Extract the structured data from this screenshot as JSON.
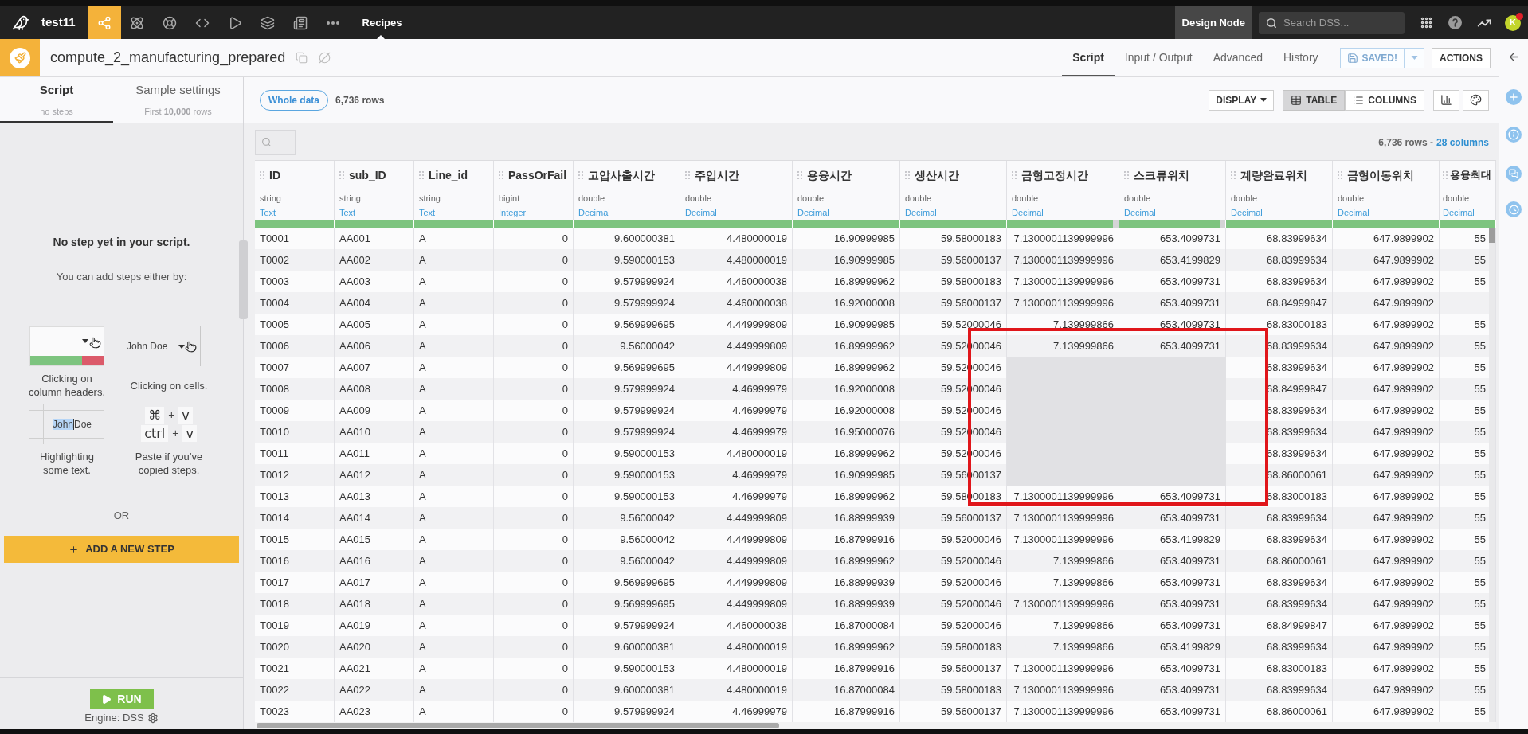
{
  "nav": {
    "project": "test11",
    "apps": [
      {
        "kind": "flow",
        "selected": true
      },
      {
        "kind": "lab",
        "selected": false
      },
      {
        "kind": "ml",
        "selected": false
      },
      {
        "kind": "code",
        "selected": false
      },
      {
        "kind": "run",
        "selected": false
      },
      {
        "kind": "stack",
        "selected": false
      },
      {
        "kind": "dashboard",
        "selected": false
      },
      {
        "kind": "more",
        "selected": false
      }
    ],
    "section": "Recipes",
    "node": "Design Node",
    "search": {
      "placeholder": "Search DSS..."
    },
    "avatar": {
      "initial": "K",
      "notification": true
    }
  },
  "recipe": {
    "title": "compute_2_manufacturing_prepared",
    "tabs": [
      {
        "label": "Script",
        "selected": true
      },
      {
        "label": "Input / Output",
        "selected": false
      },
      {
        "label": "Advanced",
        "selected": false
      },
      {
        "label": "History",
        "selected": false
      }
    ],
    "save_button": {
      "label": "SAVED!",
      "disabled": true
    },
    "actions_button": "ACTIONS"
  },
  "left_panel": {
    "tabs": [
      {
        "label": "Script",
        "sublabel": "no steps",
        "selected": true
      },
      {
        "label": "Sample settings",
        "sublabel": "First **10,000** rows",
        "selected": false
      }
    ],
    "empty_title": "No step yet in your script.",
    "empty_hint": "You can add steps either by:",
    "tips": [
      {
        "kind": "header",
        "caption": [
          "Clicking on",
          "column headers."
        ]
      },
      {
        "kind": "cell",
        "sample": "John Doe",
        "caption": [
          "Clicking on cells."
        ]
      },
      {
        "kind": "highlight",
        "selected_text": "John",
        "rest_text": "Doe",
        "caption": [
          "Highlighting",
          "some text."
        ]
      },
      {
        "kind": "paste",
        "shortcuts": [
          [
            "⌘",
            "+",
            "v"
          ],
          [
            "ctrl",
            "+",
            "v"
          ]
        ],
        "caption": [
          "Paste if you’ve",
          "copied steps."
        ]
      }
    ],
    "or": "OR",
    "add_button": "ADD A NEW STEP",
    "run_button": "RUN",
    "engine": "Engine: DSS"
  },
  "toolbar": {
    "sample_button": "Whole data",
    "row_count": "6,736 rows",
    "display_button": "DISPLAY",
    "views": [
      {
        "label": "TABLE",
        "kind": "table",
        "selected": true
      },
      {
        "label": "COLUMNS",
        "kind": "columns",
        "selected": false
      }
    ]
  },
  "table": {
    "summary": {
      "rows": "6,736 rows",
      "separator": "-",
      "columns": "28 columns"
    },
    "columns": [
      {
        "name": "ID",
        "storage": "string",
        "meaning": "Text",
        "kind": "text",
        "level": 1
      },
      {
        "name": "sub_ID",
        "storage": "string",
        "meaning": "Text",
        "kind": "text",
        "level": 1
      },
      {
        "name": "Line_id",
        "storage": "string",
        "meaning": "Text",
        "kind": "text",
        "level": 1
      },
      {
        "name": "PassOrFail",
        "storage": "bigint",
        "meaning": "Integer",
        "kind": "number",
        "level": 1
      },
      {
        "name": "고압사출시간",
        "storage": "double",
        "meaning": "Decimal",
        "kind": "number",
        "level": 1
      },
      {
        "name": "주입시간",
        "storage": "double",
        "meaning": "Decimal",
        "kind": "number",
        "level": 1
      },
      {
        "name": "용융시간",
        "storage": "double",
        "meaning": "Decimal",
        "kind": "number",
        "level": 1
      },
      {
        "name": "생산시간",
        "storage": "double",
        "meaning": "Decimal",
        "kind": "number",
        "level": 1
      },
      {
        "name": "금형고정시간",
        "storage": "double",
        "meaning": "Decimal",
        "kind": "number",
        "level": 0.95
      },
      {
        "name": "스크류위치",
        "storage": "double",
        "meaning": "Decimal",
        "kind": "number",
        "level": 0.95
      },
      {
        "name": "계량완료위치",
        "storage": "double",
        "meaning": "Decimal",
        "kind": "number",
        "level": 1
      },
      {
        "name": "금형이동위치",
        "storage": "double",
        "meaning": "Decimal",
        "kind": "number",
        "level": 1
      },
      {
        "name": "용융최대",
        "storage": "double",
        "meaning": "Decimal",
        "kind": "number",
        "level": 1
      }
    ],
    "rows": [
      [
        "T0001",
        "AA001",
        "A",
        "0",
        "9.600000381",
        "4.480000019",
        "16.90999985",
        "59.58000183",
        "7.1300001139999996",
        "653.4099731",
        "68.83999634",
        "647.9899902",
        "55"
      ],
      [
        "T0002",
        "AA002",
        "A",
        "0",
        "9.590000153",
        "4.480000019",
        "16.90999985",
        "59.56000137",
        "7.1300001139999996",
        "653.4199829",
        "68.83999634",
        "647.9899902",
        "55"
      ],
      [
        "T0003",
        "AA003",
        "A",
        "0",
        "9.579999924",
        "4.460000038",
        "16.89999962",
        "59.58000183",
        "7.1300001139999996",
        "653.4099731",
        "68.83999634",
        "647.9899902",
        "55"
      ],
      [
        "T0004",
        "AA004",
        "A",
        "0",
        "9.579999924",
        "4.460000038",
        "16.92000008",
        "59.56000137",
        "7.1300001139999996",
        "653.4099731",
        "68.84999847",
        "647.9899902",
        null
      ],
      [
        "T0005",
        "AA005",
        "A",
        "0",
        "9.569999695",
        "4.449999809",
        "16.90999985",
        "59.52000046",
        "7.139999866",
        "653.4099731",
        "68.83000183",
        "647.9899902",
        "55"
      ],
      [
        "T0006",
        "AA006",
        "A",
        "0",
        "9.56000042",
        "4.449999809",
        "16.89999962",
        "59.52000046",
        "7.139999866",
        "653.4099731",
        "68.83999634",
        "647.9899902",
        "55"
      ],
      [
        "T0007",
        "AA007",
        "A",
        "0",
        "9.569999695",
        "4.449999809",
        "16.89999962",
        "59.52000046",
        null,
        null,
        "68.83999634",
        "647.9899902",
        "55"
      ],
      [
        "T0008",
        "AA008",
        "A",
        "0",
        "9.579999924",
        "4.46999979",
        "16.92000008",
        "59.52000046",
        null,
        null,
        "68.84999847",
        "647.9899902",
        "55"
      ],
      [
        "T0009",
        "AA009",
        "A",
        "0",
        "9.579999924",
        "4.46999979",
        "16.92000008",
        "59.52000046",
        null,
        null,
        "68.83999634",
        "647.9899902",
        "55"
      ],
      [
        "T0010",
        "AA010",
        "A",
        "0",
        "9.579999924",
        "4.46999979",
        "16.95000076",
        "59.52000046",
        null,
        null,
        "68.83999634",
        "647.9899902",
        "55"
      ],
      [
        "T0011",
        "AA011",
        "A",
        "0",
        "9.590000153",
        "4.480000019",
        "16.89999962",
        "59.52000046",
        null,
        null,
        "68.83999634",
        "647.9899902",
        "55"
      ],
      [
        "T0012",
        "AA012",
        "A",
        "0",
        "9.590000153",
        "4.46999979",
        "16.90999985",
        "59.56000137",
        null,
        null,
        "68.86000061",
        "647.9899902",
        "55"
      ],
      [
        "T0013",
        "AA013",
        "A",
        "0",
        "9.590000153",
        "4.46999979",
        "16.89999962",
        "59.58000183",
        "7.1300001139999996",
        "653.4099731",
        "68.83000183",
        "647.9899902",
        "55"
      ],
      [
        "T0014",
        "AA014",
        "A",
        "0",
        "9.56000042",
        "4.449999809",
        "16.88999939",
        "59.56000137",
        "7.1300001139999996",
        "653.4099731",
        "68.83999634",
        "647.9899902",
        "55"
      ],
      [
        "T0015",
        "AA015",
        "A",
        "0",
        "9.56000042",
        "4.449999809",
        "16.87999916",
        "59.52000046",
        "7.1300001139999996",
        "653.4199829",
        "68.83999634",
        "647.9899902",
        "55"
      ],
      [
        "T0016",
        "AA016",
        "A",
        "0",
        "9.56000042",
        "4.449999809",
        "16.89999962",
        "59.52000046",
        "7.139999866",
        "653.4099731",
        "68.86000061",
        "647.9899902",
        "55"
      ],
      [
        "T0017",
        "AA017",
        "A",
        "0",
        "9.569999695",
        "4.449999809",
        "16.88999939",
        "59.52000046",
        "7.139999866",
        "653.4099731",
        "68.83999634",
        "647.9899902",
        "55"
      ],
      [
        "T0018",
        "AA018",
        "A",
        "0",
        "9.569999695",
        "4.449999809",
        "16.88999939",
        "59.52000046",
        "7.1300001139999996",
        "653.4099731",
        "68.83999634",
        "647.9899902",
        "55"
      ],
      [
        "T0019",
        "AA019",
        "A",
        "0",
        "9.579999924",
        "4.460000038",
        "16.87000084",
        "59.52000046",
        "7.139999866",
        "653.4099731",
        "68.84999847",
        "647.9899902",
        "55"
      ],
      [
        "T0020",
        "AA020",
        "A",
        "0",
        "9.600000381",
        "4.480000019",
        "16.89999962",
        "59.58000183",
        "7.139999866",
        "653.4199829",
        "68.83999634",
        "647.9899902",
        "55"
      ],
      [
        "T0021",
        "AA021",
        "A",
        "0",
        "9.590000153",
        "4.480000019",
        "16.87999916",
        "59.56000137",
        "7.1300001139999996",
        "653.4099731",
        "68.83000183",
        "647.9899902",
        "55"
      ],
      [
        "T0022",
        "AA022",
        "A",
        "0",
        "9.600000381",
        "4.480000019",
        "16.87000084",
        "59.58000183",
        "7.1300001139999996",
        "653.4099731",
        "68.83999634",
        "647.9899902",
        "55"
      ],
      [
        "T0023",
        "AA023",
        "A",
        "0",
        "9.579999924",
        "4.46999979",
        "16.87999916",
        "59.56000137",
        "7.1300001139999996",
        "653.4099731",
        "68.86000061",
        "647.9899902",
        "55"
      ]
    ]
  }
}
